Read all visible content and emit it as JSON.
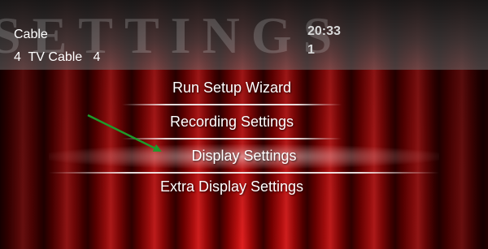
{
  "header": {
    "watermark": "SETTINGS",
    "channel_name": "Cable",
    "channel_info": "4  TV Cable   4",
    "clock": "20:33",
    "date_line": "1"
  },
  "menu": {
    "items": [
      {
        "label": "Run Setup Wizard",
        "selected": false
      },
      {
        "label": "Recording Settings",
        "selected": false
      },
      {
        "label": "Display Settings",
        "selected": true
      },
      {
        "label": "Extra Display Settings",
        "selected": false
      }
    ]
  },
  "colors": {
    "curtain": "#c01010",
    "text": "#ffffff",
    "arrow": "#1e9a2a"
  }
}
